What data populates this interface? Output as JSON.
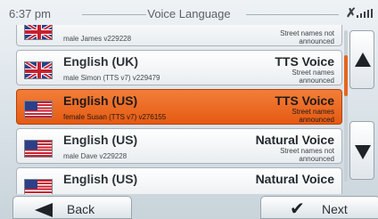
{
  "header": {
    "time": "6:37 pm",
    "title": "Voice Language",
    "gps_glyph": "✗"
  },
  "list": {
    "rows": [
      {
        "flag": "uk-flag",
        "language": "",
        "voice": "male James v229228",
        "voice_type": "",
        "street_names": "Street names not announced",
        "selected": false
      },
      {
        "flag": "uk-flag",
        "language": "English (UK)",
        "voice": "male Simon (TTS v7) v229479",
        "voice_type": "TTS Voice",
        "street_names": "Street names announced",
        "selected": false
      },
      {
        "flag": "us-flag",
        "language": "English (US)",
        "voice": "female Susan (TTS v7) v276155",
        "voice_type": "TTS Voice",
        "street_names": "Street names announced",
        "selected": true
      },
      {
        "flag": "us-flag",
        "language": "English (US)",
        "voice": "male Dave v229228",
        "voice_type": "Natural Voice",
        "street_names": "Street names not announced",
        "selected": false
      },
      {
        "flag": "us-flag",
        "language": "English (US)",
        "voice": "",
        "voice_type": "Natural Voice",
        "street_names": "",
        "selected": false
      }
    ]
  },
  "footer": {
    "back_label": "Back",
    "next_label": "Next"
  },
  "colors": {
    "selected_row": "#e8631c",
    "accent": "#e5651f"
  }
}
